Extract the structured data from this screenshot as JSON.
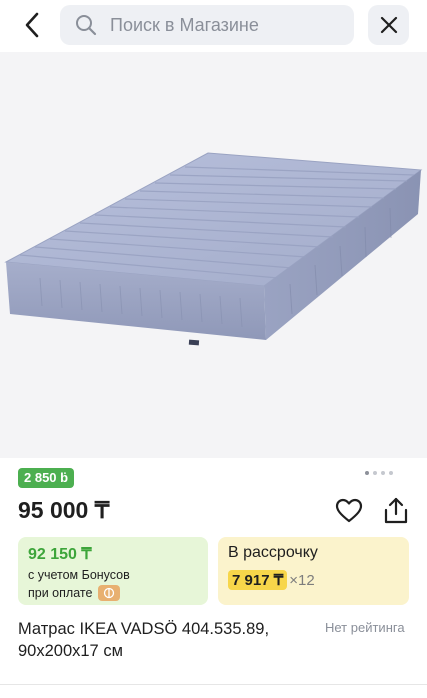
{
  "header": {
    "back_icon": "chevron-left-icon",
    "search_placeholder": "Поиск в Магазине",
    "search_icon": "search-icon",
    "close_icon": "close-icon"
  },
  "gallery": {
    "image": "mattress-photo",
    "active_dot": 1,
    "dot_count": 4
  },
  "product": {
    "bonus_badge": "2 850 ḃ",
    "price": "95 000 ₸",
    "title": "Матрас IKEA VADSÖ 404.535.89, 90x200x17 см",
    "rating": "Нет рейтинга"
  },
  "bonus_card": {
    "amount": "92 150 ₸",
    "line1": "с учетом Бонусов",
    "line2": "при оплате"
  },
  "installment_card": {
    "title": "В рассрочку",
    "monthly": "7 917 ₸",
    "multiplier": "×12"
  },
  "colors": {
    "bonus_green": "#4caf50",
    "bonus_card_bg": "#e7f6d8",
    "installment_bg": "#fbf3cc",
    "installment_highlight": "#f7d64a",
    "mattress": "#aab3d1"
  }
}
